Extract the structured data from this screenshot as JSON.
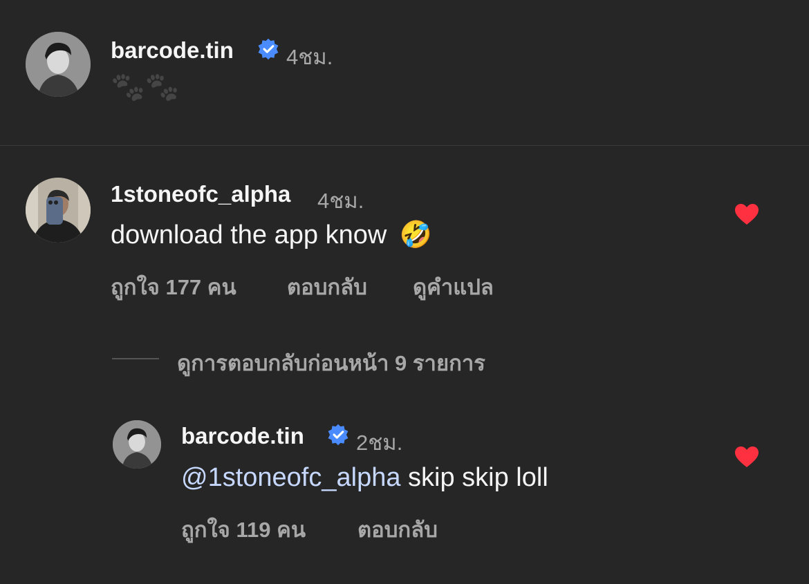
{
  "caption": {
    "username": "barcode.tin",
    "time": "4ชม.",
    "text": "🐾🐾"
  },
  "comment": {
    "username": "1stoneofc_alpha",
    "time": "4ชม.",
    "text": "download the app know",
    "emoji": "🤣",
    "likes_label": "ถูกใจ 177 คน",
    "reply_label": "ตอบกลับ",
    "translate_label": "ดูคำแปล",
    "liked": true
  },
  "view_replies_label": "ดูการตอบกลับก่อนหน้า 9 รายการ",
  "reply": {
    "username": "barcode.tin",
    "time": "2ชม.",
    "mention": "@1stoneofc_alpha",
    "text": " skip skip loll",
    "likes_label": "ถูกใจ 119 คน",
    "reply_label": "ตอบกลับ",
    "liked": true
  },
  "colors": {
    "background": "#262626",
    "heart": "#ff3040",
    "verified": "#4a8cff",
    "mention": "#c7d8ff"
  },
  "icons": {
    "verified": "verified-badge-icon",
    "heart": "heart-filled-icon"
  }
}
